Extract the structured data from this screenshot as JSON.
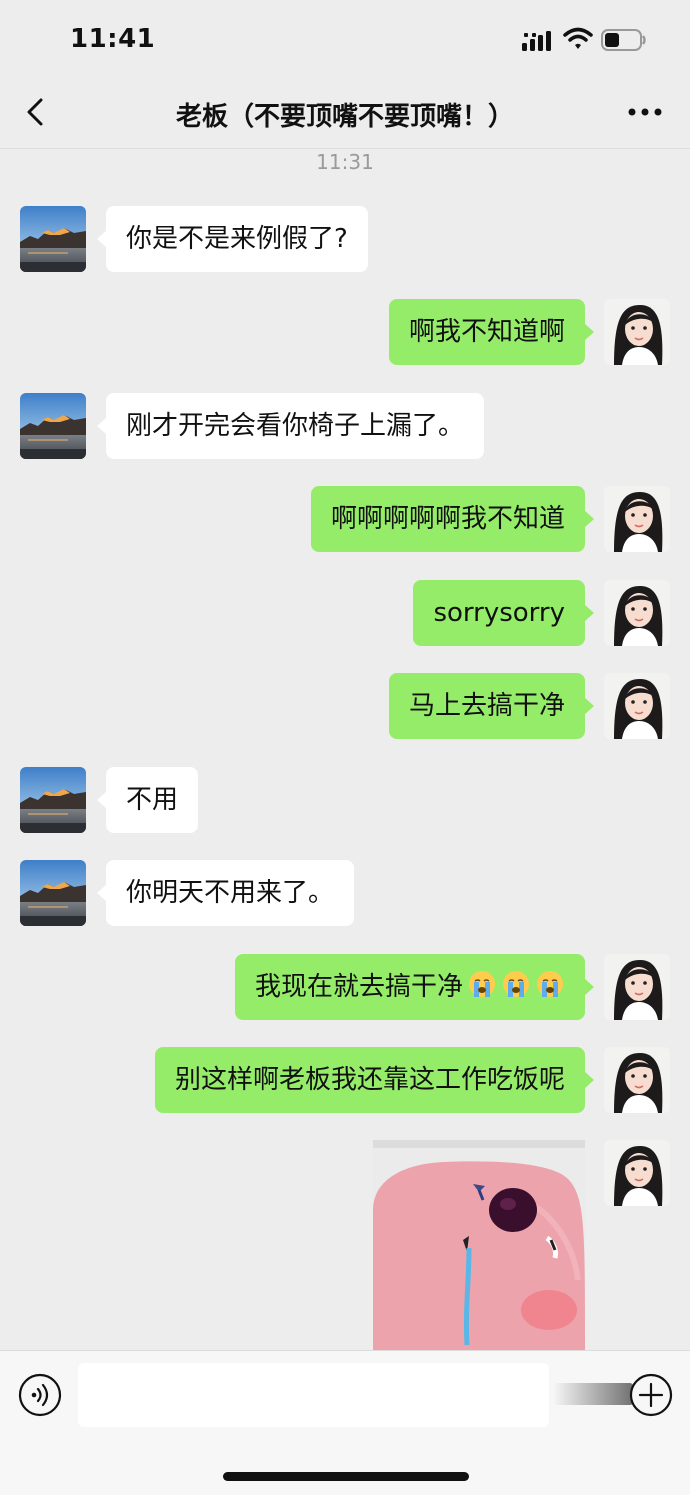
{
  "status": {
    "time": "11:41"
  },
  "nav": {
    "title": "老板（不要顶嘴不要顶嘴！）",
    "back_icon": "chevron-left-icon",
    "more_icon": "more-dots-icon"
  },
  "timestamp": "11:31",
  "messages": [
    {
      "from": "boss",
      "text": "你是不是来例假了?"
    },
    {
      "from": "me",
      "text": "啊我不知道啊"
    },
    {
      "from": "boss",
      "text": "刚才开完会看你椅子上漏了。"
    },
    {
      "from": "me",
      "text": "啊啊啊啊啊我不知道"
    },
    {
      "from": "me",
      "text": "sorrysorry"
    },
    {
      "from": "me",
      "text": "马上去搞干净"
    },
    {
      "from": "boss",
      "text": "不用"
    },
    {
      "from": "boss",
      "text": "你明天不用来了。"
    },
    {
      "from": "me",
      "text": "我现在就去搞干净",
      "emoji": "loudly-crying-face-icon",
      "emoji_count": 3
    },
    {
      "from": "me",
      "text": "别这样啊老板我还靠这工作吃饭呢"
    },
    {
      "from": "me",
      "sticker": "crying-pink-blob-sticker"
    }
  ],
  "input": {
    "placeholder": "",
    "voice_icon": "voice-icon",
    "plus_icon": "plus-circle-icon"
  },
  "colors": {
    "background": "#ededed",
    "outgoing_bubble": "#95ec69",
    "incoming_bubble": "#ffffff"
  }
}
